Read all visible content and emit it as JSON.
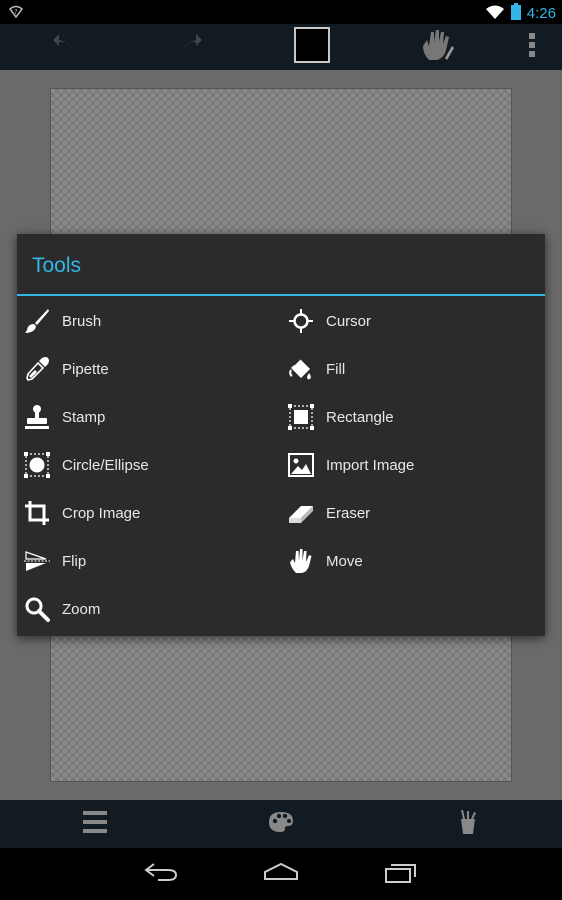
{
  "status_bar": {
    "time": "4:26",
    "icons": [
      "notification-icon",
      "wifi-icon",
      "battery-icon"
    ]
  },
  "action_bar": {
    "icons": [
      "undo-icon",
      "redo-icon",
      "color-swatch",
      "hand-tool-icon",
      "overflow-menu-icon"
    ],
    "selected_color": "#000000"
  },
  "dialog": {
    "title": "Tools",
    "accent": "#33b5e5",
    "tools": [
      {
        "label": "Brush",
        "icon": "brush-icon"
      },
      {
        "label": "Cursor",
        "icon": "cursor-icon"
      },
      {
        "label": "Pipette",
        "icon": "pipette-icon"
      },
      {
        "label": "Fill",
        "icon": "fill-icon"
      },
      {
        "label": "Stamp",
        "icon": "stamp-icon"
      },
      {
        "label": "Rectangle",
        "icon": "rectangle-icon"
      },
      {
        "label": "Circle/Ellipse",
        "icon": "circle-icon"
      },
      {
        "label": "Import Image",
        "icon": "image-icon"
      },
      {
        "label": "Crop Image",
        "icon": "crop-icon"
      },
      {
        "label": "Eraser",
        "icon": "eraser-icon"
      },
      {
        "label": "Flip",
        "icon": "flip-icon"
      },
      {
        "label": "Move",
        "icon": "move-icon"
      },
      {
        "label": "Zoom",
        "icon": "zoom-icon"
      }
    ]
  },
  "bottom_toolbar": {
    "icons": [
      "menu-icon",
      "palette-icon",
      "tools-icon"
    ]
  },
  "nav_bar": {
    "icons": [
      "back-icon",
      "home-icon",
      "recents-icon"
    ]
  }
}
